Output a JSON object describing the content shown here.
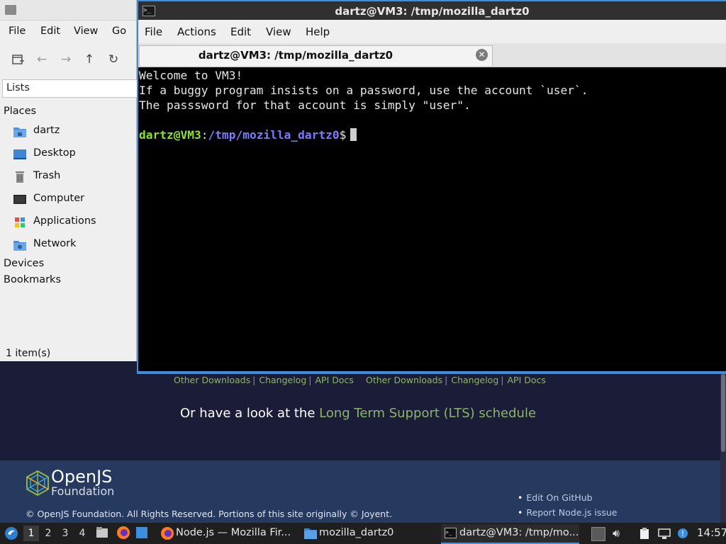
{
  "webpage": {
    "download_links_left": [
      "Other Downloads",
      "Changelog",
      "API Docs"
    ],
    "download_links_right": [
      "Other Downloads",
      "Changelog",
      "API Docs"
    ],
    "lts_prefix": "Or have a look at the ",
    "lts_link": "Long Term Support (LTS) schedule",
    "footer_brand": "OpenJS",
    "footer_brand_sub": "Foundation",
    "footer_links": [
      "Edit On GitHub",
      "Report Node.js issue"
    ],
    "copyright": "© OpenJS Foundation. All Rights Reserved. Portions of this site originally © Joyent.",
    "link_color": "#8eb36b"
  },
  "file_manager": {
    "menu": [
      "File",
      "Edit",
      "View",
      "Go"
    ],
    "toolbar_icons": [
      "new-tab-icon",
      "back-icon",
      "forward-icon",
      "up-icon",
      "reload-icon"
    ],
    "side_pane_mode": "Lists",
    "places_header": "Places",
    "places": [
      {
        "label": "dartz",
        "icon": "home-folder-icon"
      },
      {
        "label": "Desktop",
        "icon": "desktop-icon"
      },
      {
        "label": "Trash",
        "icon": "trash-icon"
      },
      {
        "label": "Computer",
        "icon": "computer-icon"
      },
      {
        "label": "Applications",
        "icon": "applications-icon"
      },
      {
        "label": "Network",
        "icon": "network-icon"
      }
    ],
    "devices_header": "Devices",
    "bookmarks_header": "Bookmarks",
    "status": "1 item(s)"
  },
  "terminal": {
    "window_title": "dartz@VM3: /tmp/mozilla_dartz0",
    "menu": [
      "File",
      "Actions",
      "Edit",
      "View",
      "Help"
    ],
    "tab_title": "dartz@VM3: /tmp/mozilla_dartz0",
    "lines": [
      "Welcome to VM3!",
      "If a buggy program insists on a password, use the account `user`.",
      "The passsword for that account is simply \"user\"."
    ],
    "prompt_user_host": "dartz@VM3",
    "prompt_colon": ":",
    "prompt_path": "/tmp/mozilla_dartz0",
    "prompt_symbol": "$",
    "prompt_user_color": "#8ae234",
    "prompt_path_color": "#7b7bff"
  },
  "taskbar": {
    "workspaces": [
      "1",
      "2",
      "3",
      "4"
    ],
    "active_workspace": "1",
    "tasks": [
      {
        "label": "Node.js — Mozilla Fir...",
        "icon": "firefox-icon"
      },
      {
        "label": "mozilla_dartz0",
        "icon": "folder-icon"
      },
      {
        "label": "dartz@VM3: /tmp/mo...",
        "icon": "terminal-icon"
      }
    ],
    "clock": "14:57"
  }
}
